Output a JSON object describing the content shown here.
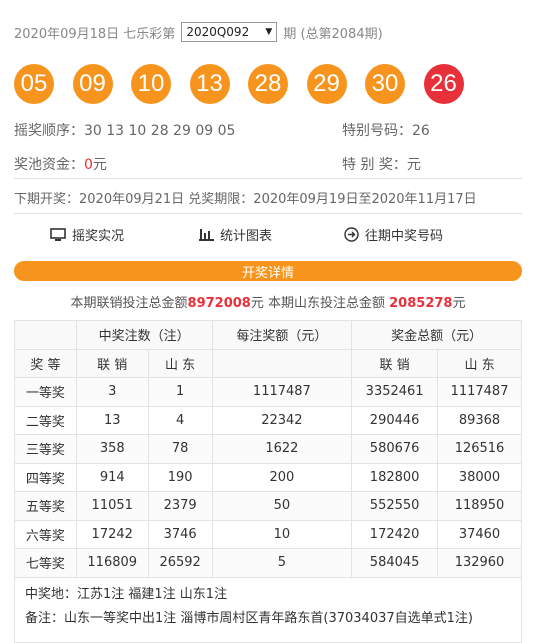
{
  "header": {
    "date_prefix": "2020年09月18日 七乐彩第",
    "issue_selected": "2020Q092",
    "issue_suffix": "期 (总第2084期)"
  },
  "balls": [
    "05",
    "09",
    "10",
    "13",
    "28",
    "29",
    "30"
  ],
  "special_ball": "26",
  "draw_order": {
    "label": "摇奖顺序：",
    "value": "30 13 10 28 29 09 05"
  },
  "special_number": {
    "label": "特别号码：",
    "value": "26"
  },
  "pool": {
    "label": "奖池资金：",
    "value": "0",
    "unit": "元"
  },
  "special_prize": {
    "label": "特 别 奖：",
    "value": "元"
  },
  "next_draw": "下期开奖：2020年09月21日 兑奖期限：2020年09月19日至2020年11月17日",
  "links": {
    "live": "摇奖实况",
    "charts": "统计图表",
    "history": "往期中奖号码"
  },
  "details_bar": "开奖详情",
  "totals": {
    "prefix": "本期联销投注总金额",
    "union_amount": "8972008",
    "middle": "元 本期山东投注总金额",
    "sd_amount": "2085278",
    "suffix": "元"
  },
  "table": {
    "col_winners": "中奖注数（注）",
    "col_per": "每注奖额（元）",
    "col_total": "奖金总额（元）",
    "col_level": "奖 等",
    "sub_union": "联 销",
    "sub_sd": "山 东",
    "rows": [
      {
        "level": "一等奖",
        "wu": "3",
        "ws": "1",
        "per": "1117487",
        "tu": "3352461",
        "ts": "1117487"
      },
      {
        "level": "二等奖",
        "wu": "13",
        "ws": "4",
        "per": "22342",
        "tu": "290446",
        "ts": "89368"
      },
      {
        "level": "三等奖",
        "wu": "358",
        "ws": "78",
        "per": "1622",
        "tu": "580676",
        "ts": "126516"
      },
      {
        "level": "四等奖",
        "wu": "914",
        "ws": "190",
        "per": "200",
        "tu": "182800",
        "ts": "38000"
      },
      {
        "level": "五等奖",
        "wu": "11051",
        "ws": "2379",
        "per": "50",
        "tu": "552550",
        "ts": "118950"
      },
      {
        "level": "六等奖",
        "wu": "17242",
        "ws": "3746",
        "per": "10",
        "tu": "172420",
        "ts": "37460"
      },
      {
        "level": "七等奖",
        "wu": "116809",
        "ws": "26592",
        "per": "5",
        "tu": "584045",
        "ts": "132960"
      }
    ]
  },
  "footer": {
    "winners_location": "中奖地：江苏1注 福建1注 山东1注",
    "remark": "备注：山东一等奖中出1注 淄博市周村区青年路东首(37034037自选单式1注)"
  },
  "colors": {
    "orange": "#f7941d",
    "red": "#e8303b"
  }
}
